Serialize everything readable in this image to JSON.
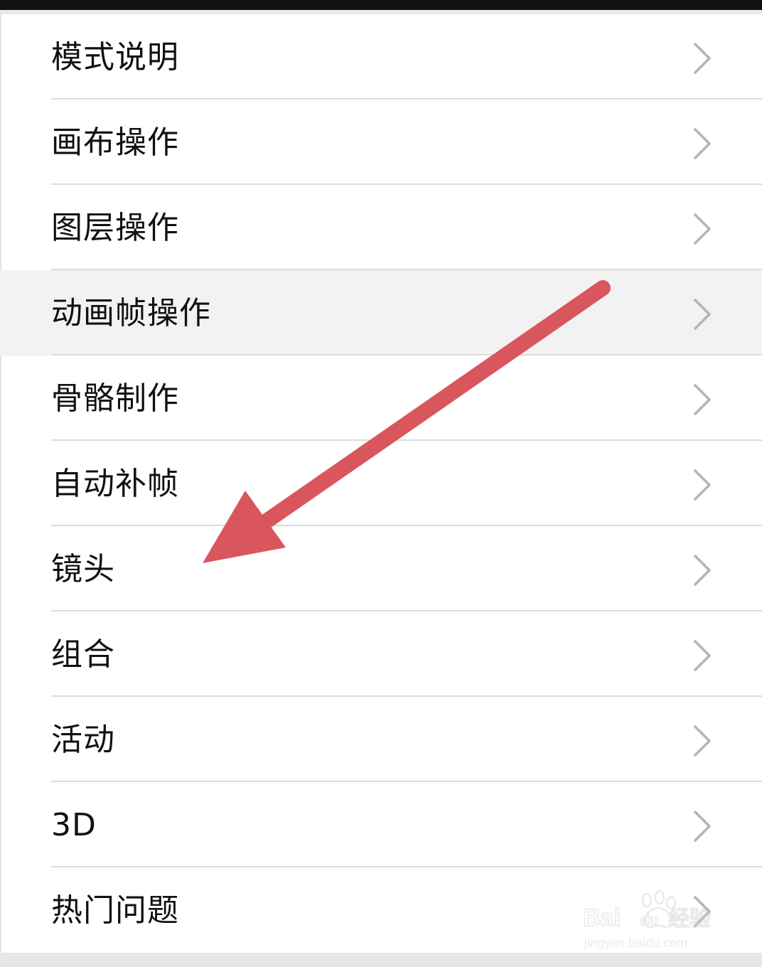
{
  "menu": {
    "items": [
      {
        "label": "模式说明"
      },
      {
        "label": "画布操作"
      },
      {
        "label": "图层操作"
      },
      {
        "label": "动画帧操作"
      },
      {
        "label": "骨骼制作"
      },
      {
        "label": "自动补帧"
      },
      {
        "label": "镜头"
      },
      {
        "label": "组合"
      },
      {
        "label": "活动"
      },
      {
        "label": "3D"
      },
      {
        "label": "热门问题"
      }
    ],
    "highlighted_index": 3
  },
  "annotation": {
    "arrow_color": "#d9565c",
    "points_to": "镜头"
  },
  "watermark": {
    "brand": "Bai du 经验",
    "url": "jingyan.baidu.com"
  },
  "colors": {
    "divider": "#dcdcdc",
    "chevron": "#b3b3b3",
    "highlight_bg": "#f2f2f2"
  }
}
